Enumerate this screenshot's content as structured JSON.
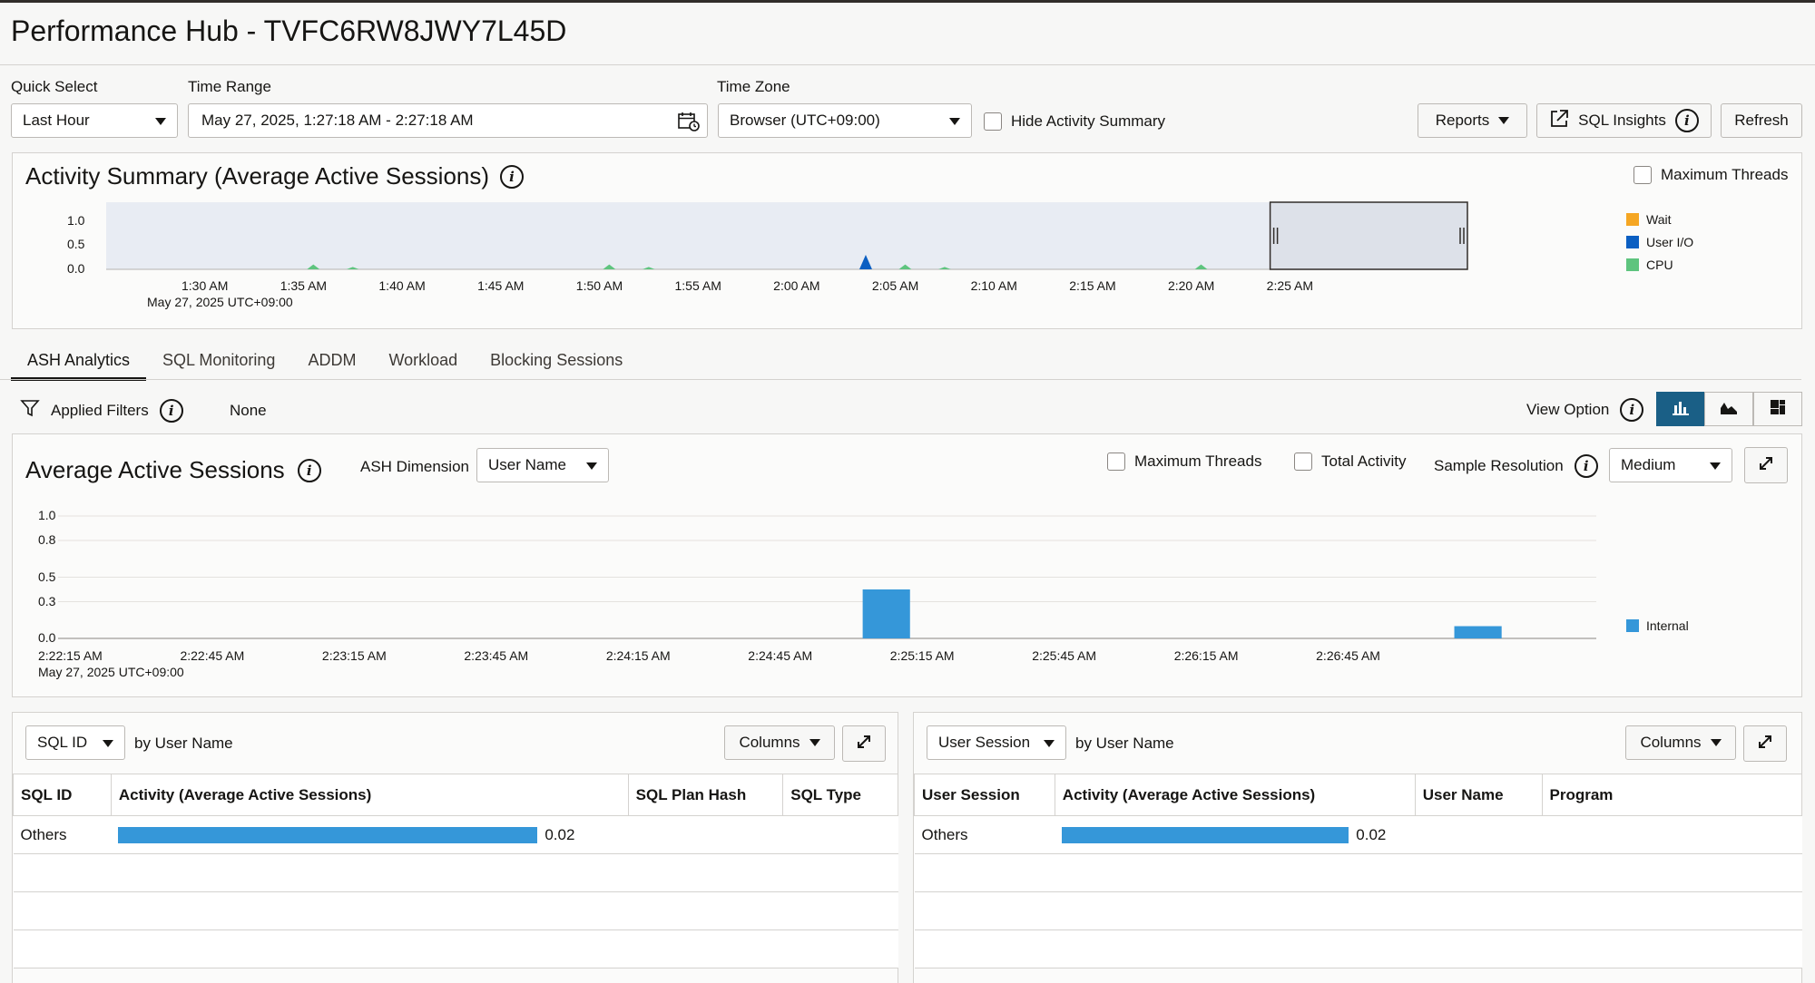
{
  "header": {
    "title": "Performance Hub - TVFC6RW8JWY7L45D"
  },
  "toolbar": {
    "quick_select_label": "Quick Select",
    "quick_select_value": "Last Hour",
    "time_range_label": "Time Range",
    "time_range_value": "May 27, 2025, 1:27:18 AM - 2:27:18 AM",
    "time_zone_label": "Time Zone",
    "time_zone_value": "Browser (UTC+09:00)",
    "hide_activity_label": "Hide Activity Summary",
    "reports_label": "Reports",
    "sql_insights_label": "SQL Insights",
    "refresh_label": "Refresh"
  },
  "activity_summary": {
    "title": "Activity Summary (Average Active Sessions)",
    "max_threads_label": "Maximum Threads",
    "date_label": "May 27, 2025 UTC+09:00",
    "legend": [
      {
        "name": "Wait",
        "color": "#f5a623"
      },
      {
        "name": "User I/O",
        "color": "#0b5fc2"
      },
      {
        "name": "CPU",
        "color": "#5ec47e"
      }
    ]
  },
  "tabs": [
    "ASH Analytics",
    "SQL Monitoring",
    "ADDM",
    "Workload",
    "Blocking Sessions"
  ],
  "filters": {
    "label": "Applied Filters",
    "value": "None",
    "view_option_label": "View Option"
  },
  "aas": {
    "title": "Average Active Sessions",
    "dimension_label": "ASH Dimension",
    "dimension_value": "User Name",
    "max_threads_label": "Maximum Threads",
    "total_activity_label": "Total Activity",
    "sample_resolution_label": "Sample Resolution",
    "sample_resolution_value": "Medium",
    "date_label": "May 27, 2025 UTC+09:00",
    "legend": "Internal"
  },
  "left_table": {
    "dimension": "SQL ID",
    "by_label": "by User Name",
    "columns_label": "Columns",
    "headers": [
      "SQL ID",
      "Activity (Average Active Sessions)",
      "SQL Plan Hash",
      "SQL Type"
    ],
    "row_label": "Others",
    "row_value": "0.02",
    "row_fraction": 1.0
  },
  "right_table": {
    "dimension": "User Session",
    "by_label": "by User Name",
    "columns_label": "Columns",
    "headers": [
      "User Session",
      "Activity (Average Active Sessions)",
      "User Name",
      "Program"
    ],
    "row_label": "Others",
    "row_value": "0.02",
    "row_fraction": 1.0
  },
  "chart_data": [
    {
      "type": "area",
      "title": "Activity Summary (Average Active Sessions)",
      "x_ticks": [
        "1:30 AM",
        "1:35 AM",
        "1:40 AM",
        "1:45 AM",
        "1:50 AM",
        "1:55 AM",
        "2:00 AM",
        "2:05 AM",
        "2:10 AM",
        "2:15 AM",
        "2:20 AM",
        "2:25 AM"
      ],
      "y_ticks": [
        "1.0",
        "0.5",
        "0.0"
      ],
      "ylim": [
        0,
        1
      ],
      "series": [
        {
          "name": "CPU",
          "color": "#5ec47e",
          "spikes": [
            {
              "time_min": 10.5,
              "value": 0.1
            },
            {
              "time_min": 12.5,
              "value": 0.05
            },
            {
              "time_min": 25.5,
              "value": 0.1
            },
            {
              "time_min": 27.5,
              "value": 0.05
            },
            {
              "time_min": 40.5,
              "value": 0.1
            },
            {
              "time_min": 42.5,
              "value": 0.05
            },
            {
              "time_min": 55.5,
              "value": 0.1
            }
          ]
        },
        {
          "name": "User I/O",
          "color": "#0b5fc2",
          "spikes": [
            {
              "time_min": 38.5,
              "value": 0.3
            }
          ]
        }
      ]
    },
    {
      "type": "bar",
      "title": "Average Active Sessions",
      "x_ticks": [
        "2:22:15 AM",
        "2:22:45 AM",
        "2:23:15 AM",
        "2:23:45 AM",
        "2:24:15 AM",
        "2:24:45 AM",
        "2:25:15 AM",
        "2:25:45 AM",
        "2:26:15 AM",
        "2:26:45 AM"
      ],
      "y_ticks": [
        "1.0",
        "0.8",
        "0.5",
        "0.3",
        "0.0"
      ],
      "ylim": [
        0,
        1
      ],
      "series": [
        {
          "name": "Internal",
          "color": "#3597d9",
          "bars": [
            {
              "start_sec": 170,
              "end_sec": 180,
              "value": 0.4
            },
            {
              "start_sec": 295,
              "end_sec": 305,
              "value": 0.1
            }
          ]
        }
      ]
    }
  ]
}
